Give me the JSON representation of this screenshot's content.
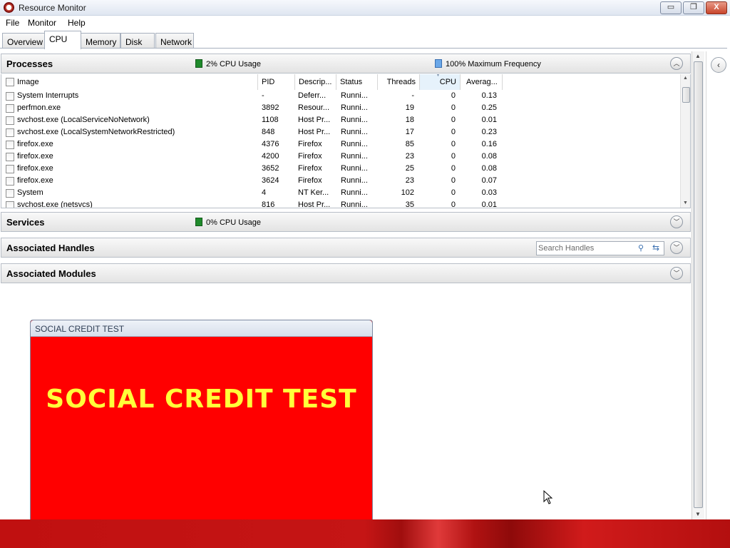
{
  "window": {
    "title": "Resource Monitor",
    "minimize_label": "▭",
    "restore_label": "❐",
    "close_label": "X"
  },
  "menu": [
    "File",
    "Monitor",
    "Help"
  ],
  "tabs": [
    "Overview",
    "CPU",
    "Memory",
    "Disk",
    "Network"
  ],
  "active_tab": "CPU",
  "processes": {
    "title": "Processes",
    "cpu_usage": "2% CPU Usage",
    "max_frequency": "100% Maximum Frequency",
    "columns": [
      "Image",
      "PID",
      "Descrip...",
      "Status",
      "Threads",
      "CPU",
      "Averag..."
    ],
    "rows": [
      [
        "System Interrupts",
        "-",
        "Deferr...",
        "Runni...",
        "-",
        "0",
        "0.13"
      ],
      [
        "perfmon.exe",
        "3892",
        "Resour...",
        "Runni...",
        "19",
        "0",
        "0.25"
      ],
      [
        "svchost.exe (LocalServiceNoNetwork)",
        "1108",
        "Host Pr...",
        "Runni...",
        "18",
        "0",
        "0.01"
      ],
      [
        "svchost.exe (LocalSystemNetworkRestricted)",
        "848",
        "Host Pr...",
        "Runni...",
        "17",
        "0",
        "0.23"
      ],
      [
        "firefox.exe",
        "4376",
        "Firefox",
        "Runni...",
        "85",
        "0",
        "0.16"
      ],
      [
        "firefox.exe",
        "4200",
        "Firefox",
        "Runni...",
        "23",
        "0",
        "0.08"
      ],
      [
        "firefox.exe",
        "3652",
        "Firefox",
        "Runni...",
        "25",
        "0",
        "0.08"
      ],
      [
        "firefox.exe",
        "3624",
        "Firefox",
        "Runni...",
        "23",
        "0",
        "0.07"
      ],
      [
        "System",
        "4",
        "NT Ker...",
        "Runni...",
        "102",
        "0",
        "0.03"
      ],
      [
        "svchost.exe (netsvcs)",
        "816",
        "Host Pr...",
        "Runni...",
        "35",
        "0",
        "0.01"
      ]
    ]
  },
  "services": {
    "title": "Services",
    "cpu_usage": "0% CPU Usage"
  },
  "handles": {
    "title": "Associated Handles",
    "search_placeholder": "Search Handles"
  },
  "modules": {
    "title": "Associated Modules"
  },
  "overlay": {
    "title": "SOCIAL CREDIT TEST",
    "heading": "SOCIAL CREDIT TEST"
  },
  "colors": {
    "overlay_bg": "#ff0000",
    "overlay_text": "#ffff3a",
    "taskbar": "#c01010",
    "cpu_green": "#1f8a2b",
    "freq_blue": "#6aa7e8"
  },
  "icons": [
    "app-icon",
    "search-icon",
    "refresh-icon",
    "chevron-up-icon",
    "chevron-down-icon",
    "chevron-left-icon",
    "mouse-cursor-icon"
  ]
}
